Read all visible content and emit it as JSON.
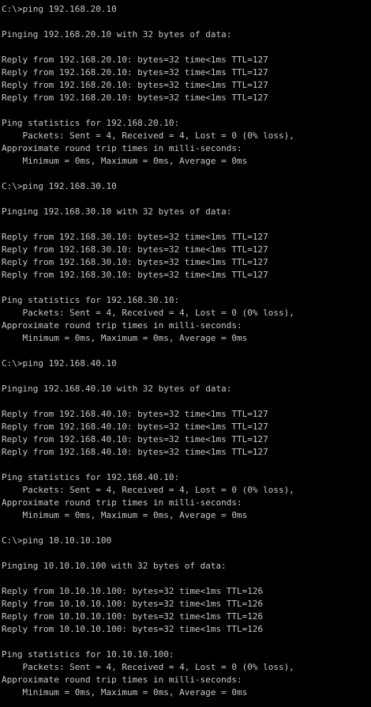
{
  "console": {
    "lines": [
      "C:\\>ping 192.168.20.10",
      "",
      "Pinging 192.168.20.10 with 32 bytes of data:",
      "",
      "Reply from 192.168.20.10: bytes=32 time<1ms TTL=127",
      "Reply from 192.168.20.10: bytes=32 time<1ms TTL=127",
      "Reply from 192.168.20.10: bytes=32 time<1ms TTL=127",
      "Reply from 192.168.20.10: bytes=32 time<1ms TTL=127",
      "",
      "Ping statistics for 192.168.20.10:",
      "    Packets: Sent = 4, Received = 4, Lost = 0 (0% loss),",
      "Approximate round trip times in milli-seconds:",
      "    Minimum = 0ms, Maximum = 0ms, Average = 0ms",
      "",
      "C:\\>ping 192.168.30.10",
      "",
      "Pinging 192.168.30.10 with 32 bytes of data:",
      "",
      "Reply from 192.168.30.10: bytes=32 time<1ms TTL=127",
      "Reply from 192.168.30.10: bytes=32 time<1ms TTL=127",
      "Reply from 192.168.30.10: bytes=32 time<1ms TTL=127",
      "Reply from 192.168.30.10: bytes=32 time<1ms TTL=127",
      "",
      "Ping statistics for 192.168.30.10:",
      "    Packets: Sent = 4, Received = 4, Lost = 0 (0% loss),",
      "Approximate round trip times in milli-seconds:",
      "    Minimum = 0ms, Maximum = 0ms, Average = 0ms",
      "",
      "C:\\>ping 192.168.40.10",
      "",
      "Pinging 192.168.40.10 with 32 bytes of data:",
      "",
      "Reply from 192.168.40.10: bytes=32 time<1ms TTL=127",
      "Reply from 192.168.40.10: bytes=32 time<1ms TTL=127",
      "Reply from 192.168.40.10: bytes=32 time<1ms TTL=127",
      "Reply from 192.168.40.10: bytes=32 time<1ms TTL=127",
      "",
      "Ping statistics for 192.168.40.10:",
      "    Packets: Sent = 4, Received = 4, Lost = 0 (0% loss),",
      "Approximate round trip times in milli-seconds:",
      "    Minimum = 0ms, Maximum = 0ms, Average = 0ms",
      "",
      "C:\\>ping 10.10.10.100",
      "",
      "Pinging 10.10.10.100 with 32 bytes of data:",
      "",
      "Reply from 10.10.10.100: bytes=32 time<1ms TTL=126",
      "Reply from 10.10.10.100: bytes=32 time<1ms TTL=126",
      "Reply from 10.10.10.100: bytes=32 time<1ms TTL=126",
      "Reply from 10.10.10.100: bytes=32 time<1ms TTL=126",
      "",
      "Ping statistics for 10.10.10.100:",
      "    Packets: Sent = 4, Received = 4, Lost = 0 (0% loss),",
      "Approximate round trip times in milli-seconds:",
      "    Minimum = 0ms, Maximum = 0ms, Average = 0ms"
    ]
  },
  "colors": {
    "background": "#000000",
    "text": "#c8c8c8"
  }
}
